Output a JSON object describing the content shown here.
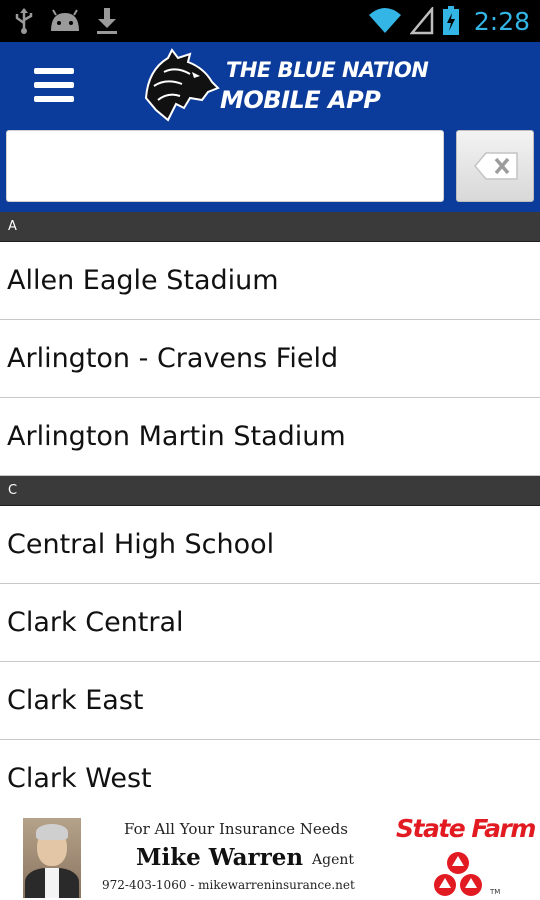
{
  "status_bar": {
    "time": "2:28",
    "icons": [
      "usb-icon",
      "android-debug-icon",
      "download-icon",
      "wifi-icon",
      "signal-icon",
      "battery-charging-icon"
    ],
    "accent_color": "#33b5e5"
  },
  "header": {
    "menu_icon": "hamburger-menu-icon",
    "logo_line1": "THE BLUE NATION",
    "logo_line2": "MOBILE APP",
    "background_color": "#0c3c9b"
  },
  "search": {
    "value": "",
    "placeholder": "",
    "clear_icon": "backspace-icon"
  },
  "list": {
    "sections": [
      {
        "letter": "A",
        "items": [
          "Allen Eagle Stadium",
          "Arlington - Cravens Field",
          "Arlington Martin Stadium"
        ]
      },
      {
        "letter": "C",
        "items": [
          "Central High School",
          "Clark Central",
          "Clark East",
          "Clark West"
        ]
      }
    ]
  },
  "ad": {
    "tagline": "For All Your Insurance Needs",
    "name": "Mike Warren",
    "title": "Agent",
    "contact": "972-403-1060 - mikewarreninsurance.net",
    "brand": "State Farm",
    "brand_color": "#e21b22"
  }
}
